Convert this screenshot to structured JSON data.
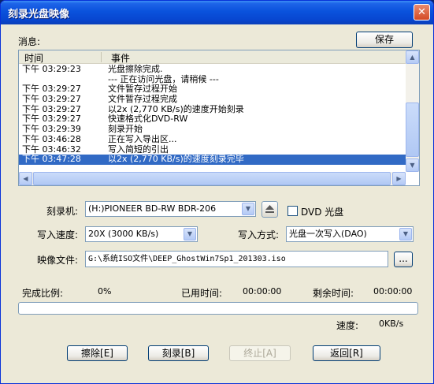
{
  "window": {
    "title": "刻录光盘映像",
    "close_glyph": "✕"
  },
  "log": {
    "label": "消息:",
    "save_button": "保存",
    "columns": [
      "时间",
      "事件"
    ],
    "rows": [
      {
        "time": "下午 03:29:23",
        "event": "光盘擦除完成."
      },
      {
        "time": "",
        "event": "--- 正在访问光盘，请稍候 ---"
      },
      {
        "time": "下午 03:29:27",
        "event": "文件暂存过程开始"
      },
      {
        "time": "下午 03:29:27",
        "event": "文件暂存过程完成"
      },
      {
        "time": "下午 03:29:27",
        "event": "以2x (2,770 KB/s)的速度开始刻录"
      },
      {
        "time": "下午 03:29:27",
        "event": "快速格式化DVD-RW"
      },
      {
        "time": "下午 03:29:39",
        "event": "刻录开始"
      },
      {
        "time": "下午 03:46:28",
        "event": "正在写入导出区..."
      },
      {
        "time": "下午 03:46:32",
        "event": "写入简短的引出"
      },
      {
        "time": "下午 03:47:28",
        "event": "以2x (2,770 KB/s)的速度刻录完毕",
        "selected": true
      }
    ]
  },
  "burner": {
    "label": "刻录机:",
    "value": "(H:)PIONEER  BD-RW   BDR-206",
    "dvd_checkbox_label": "DVD 光盘",
    "dvd_checked": false
  },
  "speed": {
    "label": "写入速度:",
    "value": "20X (3000 KB/s)"
  },
  "write_mode": {
    "label": "写入方式:",
    "value": "光盘一次写入(DAO)"
  },
  "image_file": {
    "label": "映像文件:",
    "value": "G:\\系统ISO文件\\DEEP_GhostWin7Sp1_201303.iso",
    "browse_label": "..."
  },
  "status": {
    "completion_label": "完成比例:",
    "completion_value": "0%",
    "elapsed_label": "已用时间:",
    "elapsed_value": "00:00:00",
    "remaining_label": "剩余时间:",
    "remaining_value": "00:00:00",
    "progress_fraction": 0,
    "speed_label": "速度:",
    "speed_value": "0KB/s"
  },
  "buttons": {
    "erase": "擦除[E]",
    "burn": "刻录[B]",
    "stop": "终止[A]",
    "back": "返回[R]"
  }
}
